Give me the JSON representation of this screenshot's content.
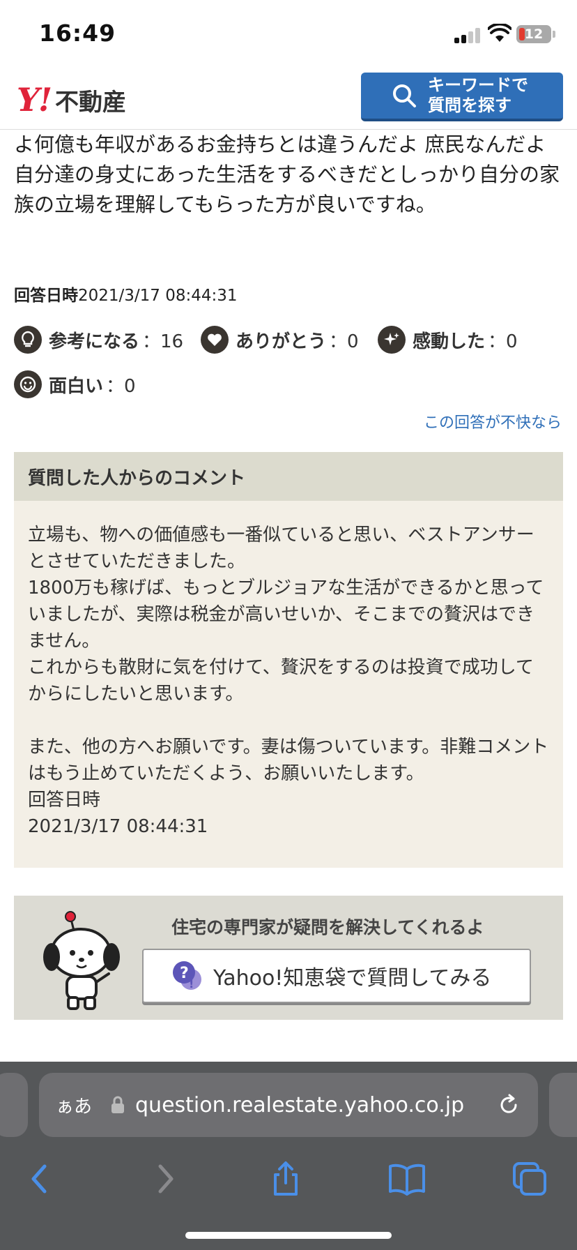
{
  "status_bar": {
    "time": "16:49",
    "battery": "12"
  },
  "header": {
    "logo_mark": "Y!",
    "logo_text": "不動産",
    "keyword_button": "キーワードで\n質問を探す"
  },
  "answer": {
    "text": "よ何億も年収があるお金持ちとは違うんだよ 庶民なんだよ 自分達の身丈にあった生活をするべきだとしっかり自分の家族の立場を理解してもらった方が良いですね。",
    "date_label": "回答日時",
    "date_value": "2021/3/17 08:44:31"
  },
  "reactions": [
    {
      "label": "参考になる",
      "count": "：16",
      "icon": "lightbulb-icon"
    },
    {
      "label": "ありがとう",
      "count": "：0",
      "icon": "heart-icon"
    },
    {
      "label": "感動した",
      "count": "：0",
      "icon": "sparkle-icon"
    },
    {
      "label": "面白い",
      "count": "：0",
      "icon": "smile-icon"
    }
  ],
  "report_link": "この回答が不快なら",
  "comment": {
    "heading": "質問した人からのコメント",
    "body": "立場も、物への価値感も一番似ていると思い、ベストアンサーとさせていただきました。\n1800万も稼げば、もっとブルジョアな生活ができるかと思っていましたが、実際は税金が高いせいか、そこまでの贅沢はできません。\nこれからも散財に気を付けて、贅沢をするのは投資で成功してからにしたいと思います。\n\nまた、他の方へお願いです。妻は傷ついています。非難コメントはもう止めていただくよう、お願いいたします。",
    "date_label": "回答日時",
    "date_value": "2021/3/17 08:44:31"
  },
  "promo": {
    "text": "住宅の専門家が疑問を解決してくれるよ",
    "button": "Yahoo!知恵袋で質問してみる"
  },
  "browser": {
    "aa": "ぁあ",
    "url": "question.realestate.yahoo.co.jp"
  },
  "colors": {
    "accent_blue": "#2f6fb8",
    "logo_red": "#e0233a",
    "comment_bg": "#f3efe6",
    "comment_head_bg": "#dcdbce"
  }
}
